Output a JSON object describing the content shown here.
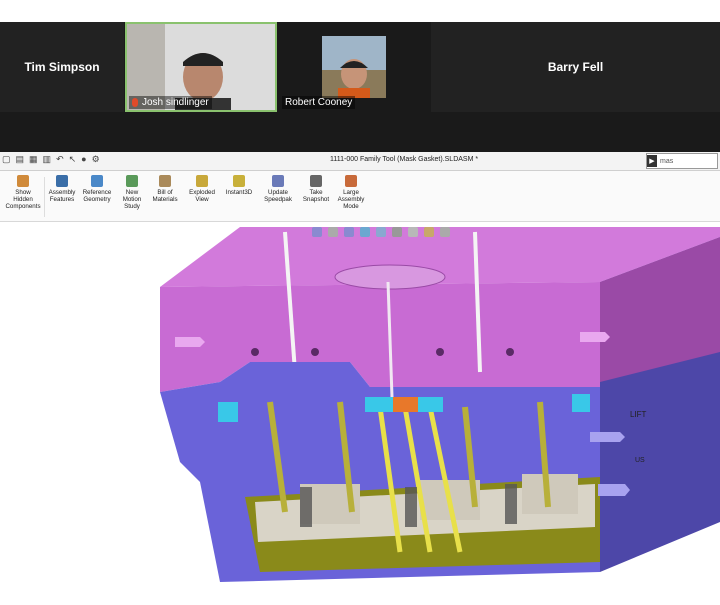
{
  "participants": [
    {
      "name": "Tim Simpson",
      "camera": false
    },
    {
      "name": "Josh sindlinger",
      "camera": true,
      "active_speaker": true,
      "muted": true
    },
    {
      "name": "Robert Cooney",
      "camera": true
    },
    {
      "name": "Barry Fell",
      "camera": false
    }
  ],
  "solidworks": {
    "document_title": "1111-000 Family Tool (Mask Gasket).SLDASM *",
    "search_value": "mas",
    "commands": [
      {
        "label": "Show\nHidden\nComponents",
        "icon": "show-hidden-icon"
      },
      {
        "label": "Assembly\nFeatures",
        "icon": "assembly-features-icon"
      },
      {
        "label": "Reference\nGeometry",
        "icon": "reference-geometry-icon"
      },
      {
        "label": "New\nMotion\nStudy",
        "icon": "motion-study-icon"
      },
      {
        "label": "Bill of\nMaterials",
        "icon": "bom-icon"
      },
      {
        "label": "Exploded\nView",
        "icon": "exploded-view-icon"
      },
      {
        "label": "Instant3D",
        "icon": "instant3d-icon"
      },
      {
        "label": "Update\nSpeedpak",
        "icon": "speedpak-icon"
      },
      {
        "label": "Take\nSnapshot",
        "icon": "snapshot-icon"
      },
      {
        "label": "Large\nAssembly\nMode",
        "icon": "large-assembly-icon"
      }
    ],
    "model_labels": {
      "right_face": "LIFT",
      "lower_right": "US"
    },
    "colors": {
      "magenta": "#c86bd3",
      "magenta_dark": "#9a4aa6",
      "blue": "#6a63d9",
      "blue_dark": "#4d47a8",
      "olive": "#8a8a1a",
      "yellow": "#e8e04a",
      "gray": "#d9d4c7",
      "cyan": "#39c8e8",
      "orange": "#e8782a"
    }
  }
}
